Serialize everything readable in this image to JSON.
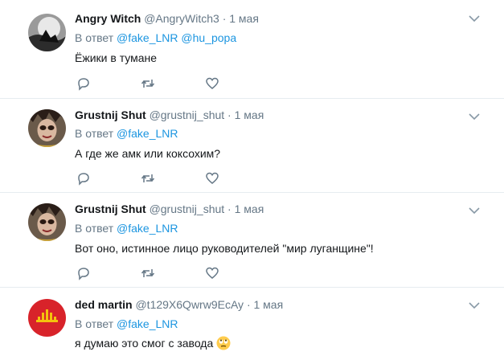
{
  "tweets": [
    {
      "name": "Angry Witch",
      "handle": "@AngryWitch3",
      "dot": "·",
      "time": "1 мая",
      "reply_prefix": "В ответ",
      "mentions": [
        "@fake_LNR",
        "@hu_popa"
      ],
      "text": "Ёжики в тумане"
    },
    {
      "name": "Grustnij Shut",
      "handle": "@grustnij_shut",
      "dot": "·",
      "time": "1 мая",
      "reply_prefix": "В ответ",
      "mentions": [
        "@fake_LNR"
      ],
      "text": "А где же амк или коксохим?"
    },
    {
      "name": "Grustnij Shut",
      "handle": "@grustnij_shut",
      "dot": "·",
      "time": "1 мая",
      "reply_prefix": "В ответ",
      "mentions": [
        "@fake_LNR"
      ],
      "text": "Вот оно, истинное лицо руководителей \"мир луганщине\"!"
    },
    {
      "name": "ded martin",
      "handle": "@t129X6Qwrw9EcAy",
      "dot": "·",
      "time": "1 мая",
      "reply_prefix": "В ответ",
      "mentions": [
        "@fake_LNR"
      ],
      "text": "я думаю это смог с завода",
      "emoji_icon": "rolling-eyes-emoji-icon"
    }
  ],
  "icons": {
    "reply": "reply-icon",
    "retweet": "retweet-icon",
    "like": "heart-icon",
    "menu": "chevron-down-icon"
  },
  "colors": {
    "link": "#1b95e0",
    "muted": "#657786",
    "text": "#14171a",
    "divider": "#e6ecf0"
  }
}
